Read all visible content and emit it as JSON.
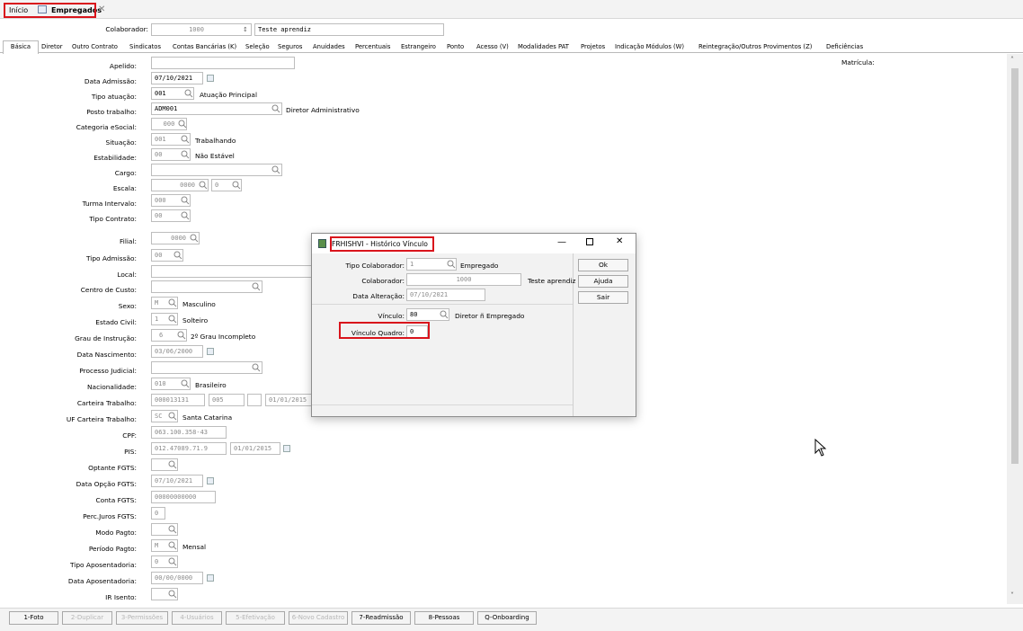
{
  "tabs": {
    "inicio": "Início",
    "empregados": "Empregados"
  },
  "colaborador": {
    "label": "Colaborador:",
    "code": "1000",
    "name": "Teste aprendiz"
  },
  "subtabs": [
    "Básica",
    "Diretor",
    "Outro Contrato",
    "Sindicatos",
    "Contas Bancárias (K)",
    "Seleção",
    "Seguros",
    "Anuidades",
    "Percentuais",
    "Estrangeiro",
    "Ponto",
    "Acesso (V)",
    "Modalidades PAT",
    "Projetos",
    "Indicação Módulos (W)",
    "Reintegração/Outros Provimentos (Z)",
    "Deficiências"
  ],
  "matricula_label": "Matrícula:",
  "fields": {
    "apelido": {
      "label": "Apelido:",
      "value": ""
    },
    "data_admissao": {
      "label": "Data Admissão:",
      "value": "07/10/2021"
    },
    "tipo_atuacao": {
      "label": "Tipo atuação:",
      "value": "001",
      "desc": "Atuação Principal"
    },
    "posto_trabalho": {
      "label": "Posto trabalho:",
      "value": "ADM001",
      "desc": "Diretor Administrativo"
    },
    "categoria_esocial": {
      "label": "Categoria eSocial:",
      "value": "000"
    },
    "situacao": {
      "label": "Situação:",
      "value": "001",
      "desc": "Trabalhando"
    },
    "estabilidade": {
      "label": "Estabilidade:",
      "value": "00",
      "desc": "Não Estável"
    },
    "cargo": {
      "label": "Cargo:",
      "value": ""
    },
    "escala": {
      "label": "Escala:",
      "value": "0000",
      "value2": "0"
    },
    "turma_intervalo": {
      "label": "Turma Intervalo:",
      "value": "000"
    },
    "tipo_contrato": {
      "label": "Tipo Contrato:",
      "value": "00"
    },
    "filial": {
      "label": "Filial:",
      "value": "0000"
    },
    "tipo_admissao": {
      "label": "Tipo Admissão:",
      "value": "00"
    },
    "local": {
      "label": "Local:",
      "value": ""
    },
    "centro_custo": {
      "label": "Centro de Custo:",
      "value": ""
    },
    "sexo": {
      "label": "Sexo:",
      "value": "M",
      "desc": "Masculino"
    },
    "estado_civil": {
      "label": "Estado Civil:",
      "value": "1",
      "desc": "Solteiro"
    },
    "grau_instrucao": {
      "label": "Grau de Instrução:",
      "value": "6",
      "desc": "2º Grau Incompleto"
    },
    "data_nascimento": {
      "label": "Data Nascimento:",
      "value": "03/06/2000"
    },
    "processo_judicial": {
      "label": "Processo Judicial:",
      "value": ""
    },
    "nacionalidade": {
      "label": "Nacionalidade:",
      "value": "010",
      "desc": "Brasileiro"
    },
    "carteira_trabalho": {
      "label": "Carteira Trabalho:",
      "value": "000013131",
      "serie": "005",
      "digito": "",
      "data": "01/01/2015"
    },
    "uf_carteira": {
      "label": "UF Carteira Trabalho:",
      "value": "SC",
      "desc": "Santa Catarina"
    },
    "cpf": {
      "label": "CPF:",
      "value": "063.100.358-43"
    },
    "pis": {
      "label": "PIS:",
      "value": "012.47089.71.9",
      "data": "01/01/2015"
    },
    "optante_fgts": {
      "label": "Optante FGTS:",
      "value": ""
    },
    "data_opcao_fgts": {
      "label": "Data Opção FGTS:",
      "value": "07/10/2021"
    },
    "conta_fgts": {
      "label": "Conta FGTS:",
      "value": "00000000000"
    },
    "perc_juros_fgts": {
      "label": "Perc.Juros FGTS:",
      "value": "0"
    },
    "modo_pagto": {
      "label": "Modo Pagto:",
      "value": ""
    },
    "periodo_pagto": {
      "label": "Período Pagto:",
      "value": "M",
      "desc": "Mensal"
    },
    "tipo_aposentadoria": {
      "label": "Tipo Aposentadoria:",
      "value": "0"
    },
    "data_aposentadoria": {
      "label": "Data Aposentadoria:",
      "value": "00/00/0000"
    },
    "ir_isento": {
      "label": "IR Isento:",
      "value": ""
    }
  },
  "footer_buttons": [
    {
      "label": "1-Foto",
      "enabled": true
    },
    {
      "label": "2-Duplicar",
      "enabled": false
    },
    {
      "label": "3-Permissões",
      "enabled": false
    },
    {
      "label": "4-Usuários",
      "enabled": false
    },
    {
      "label": "5-Efetivação",
      "enabled": false
    },
    {
      "label": "6-Novo Cadastro",
      "enabled": false
    },
    {
      "label": "7-Readmissão",
      "enabled": true
    },
    {
      "label": "8-Pessoas",
      "enabled": true
    },
    {
      "label": "Q-Onboarding",
      "enabled": true
    }
  ],
  "dialog": {
    "title": "FRHISHVI - Histórico Vínculo",
    "tipo_colaborador": {
      "label": "Tipo Colaborador:",
      "value": "1",
      "desc": "Empregado"
    },
    "colaborador": {
      "label": "Colaborador:",
      "value": "1000",
      "desc": "Teste aprendiz"
    },
    "data_alteracao": {
      "label": "Data Alteração:",
      "value": "07/10/2021"
    },
    "vinculo": {
      "label": "Vínculo:",
      "value": "80",
      "desc": "Diretor ñ Empregado"
    },
    "vinculo_quadro": {
      "label": "Vínculo Quadro:",
      "value": "0"
    },
    "buttons": {
      "ok": "Ok",
      "ajuda": "Ajuda",
      "sair": "Sair"
    }
  }
}
